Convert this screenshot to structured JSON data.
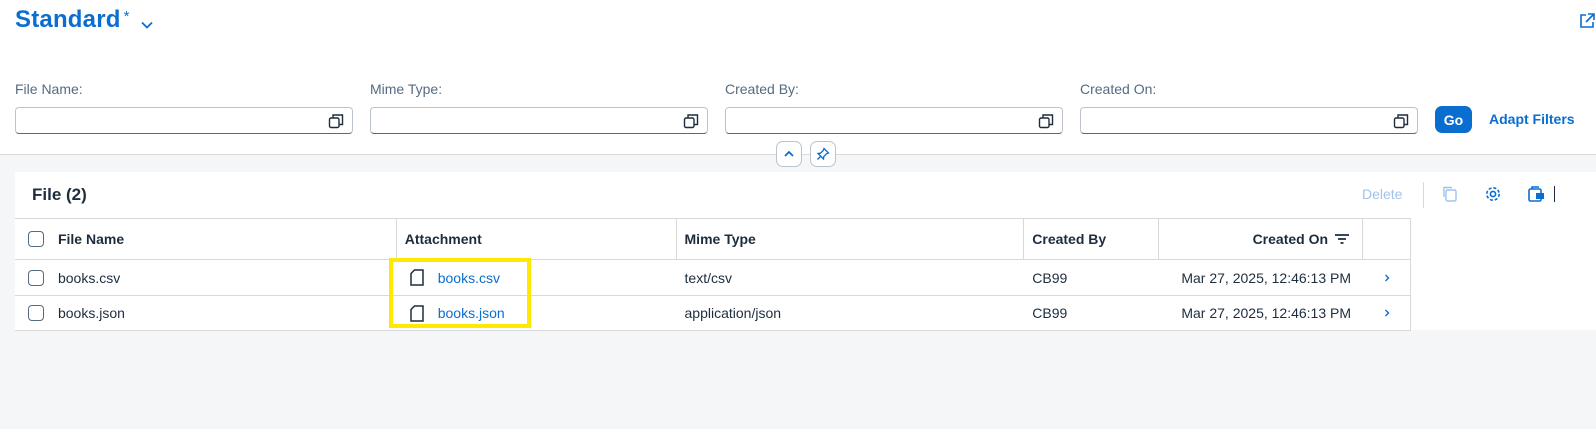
{
  "variant": {
    "title": "Standard",
    "modified_marker": "*"
  },
  "filters": [
    {
      "label": "File Name:",
      "value": ""
    },
    {
      "label": "Mime Type:",
      "value": ""
    },
    {
      "label": "Created By:",
      "value": ""
    },
    {
      "label": "Created On:",
      "value": ""
    }
  ],
  "filter_bar": {
    "go_label": "Go",
    "adapt_label": "Adapt Filters"
  },
  "table": {
    "title": "File (2)",
    "delete_label": "Delete",
    "columns": [
      "File Name",
      "Attachment",
      "Mime Type",
      "Created By",
      "Created On"
    ],
    "rows": [
      {
        "file_name": "books.csv",
        "attachment": "books.csv",
        "mime_type": "text/csv",
        "created_by": "CB99",
        "created_on": "Mar 27, 2025, 12:46:13 PM"
      },
      {
        "file_name": "books.json",
        "attachment": "books.json",
        "mime_type": "application/json",
        "created_by": "CB99",
        "created_on": "Mar 27, 2025, 12:46:13 PM"
      }
    ]
  },
  "colors": {
    "brand": "#0a6ed1",
    "text": "#1d2d3e",
    "highlight": "#ffe900"
  },
  "icons": [
    "chevron-down-icon",
    "share-icon",
    "value-help-icon",
    "collapse-icon",
    "pin-icon",
    "copy-icon",
    "settings-icon",
    "export-icon",
    "file-icon",
    "sort-icon",
    "chevron-right-icon"
  ]
}
